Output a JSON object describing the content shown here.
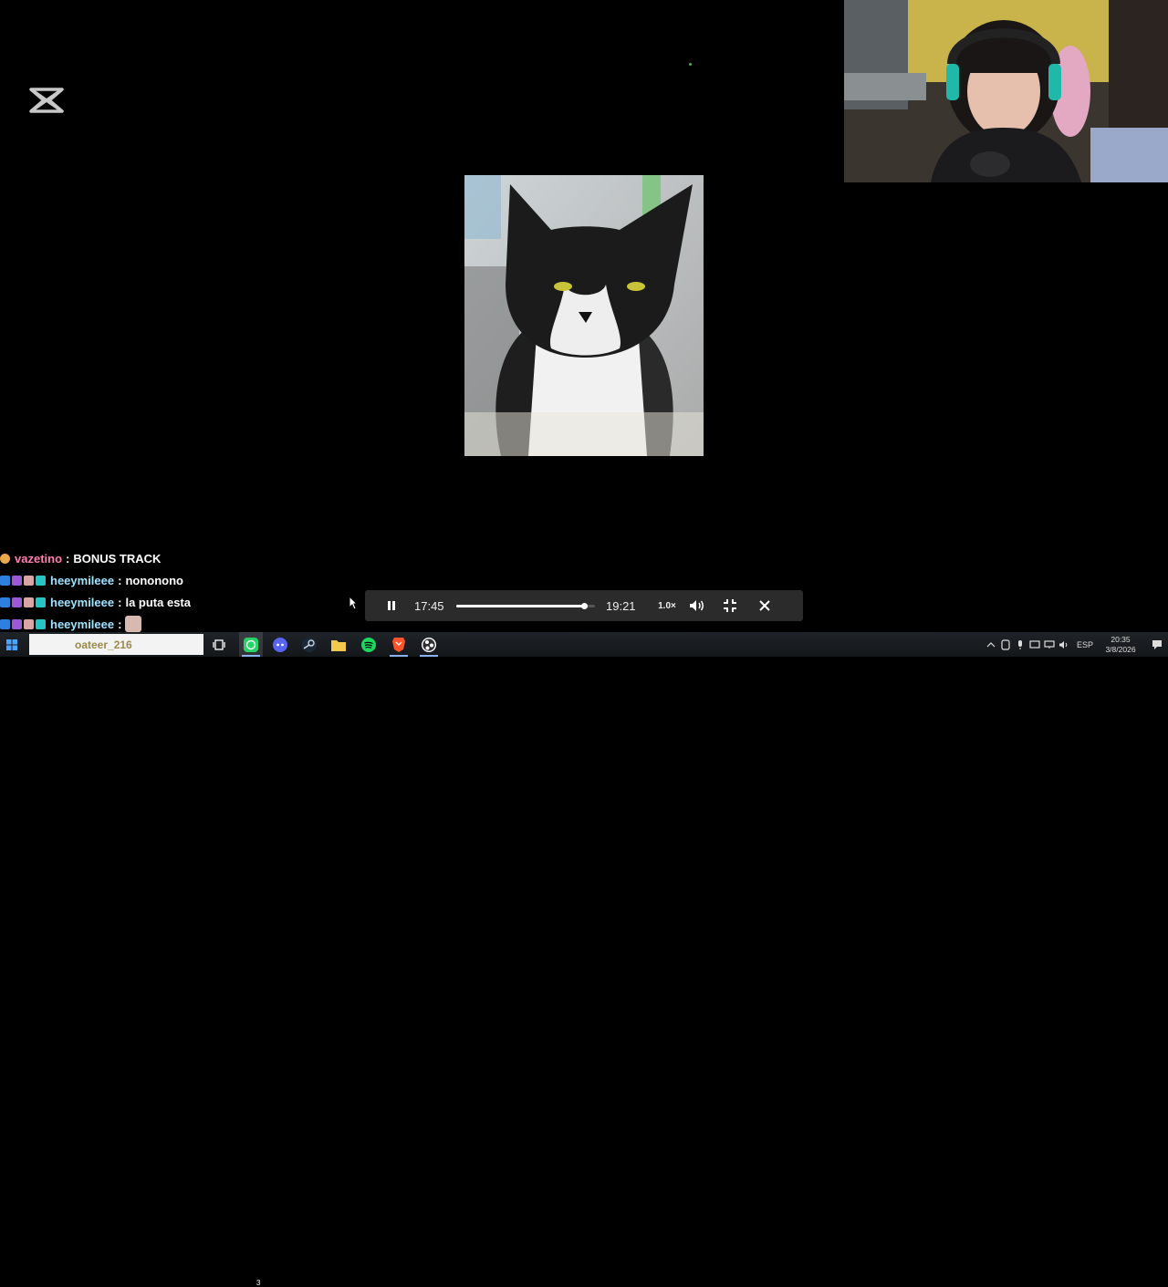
{
  "chat": {
    "lines": [
      {
        "user": "vazetino",
        "user_color": "#ff7fb1",
        "message": "BONUS TRACK"
      },
      {
        "user": "heeymileee",
        "user_color": "#9fe3ff",
        "message": "nononono"
      },
      {
        "user": "heeymileee",
        "user_color": "#9fe3ff",
        "message": "la puta esta"
      },
      {
        "user": "heeymileee",
        "user_color": "#9fe3ff",
        "message": ""
      },
      {
        "user": "oateer_216",
        "user_color": "#c9a642",
        "message": ""
      }
    ],
    "separator": ":"
  },
  "player": {
    "current_time": "17:45",
    "total_time": "19:21",
    "speed": "1.0×",
    "progress": 0.92
  },
  "taskbar": {
    "whatsapp_badge": "3",
    "language": "ESP",
    "time": "20:35",
    "date": "3/8/2026"
  },
  "colors": {
    "accent": "#8ab4f8",
    "player_bg": "#2b2b2b"
  },
  "icons": {
    "app": "capcut-icon",
    "pause": "pause-icon",
    "volume": "volume-icon",
    "exit_fullscreen": "exit-fullscreen-icon",
    "close": "close-icon"
  }
}
